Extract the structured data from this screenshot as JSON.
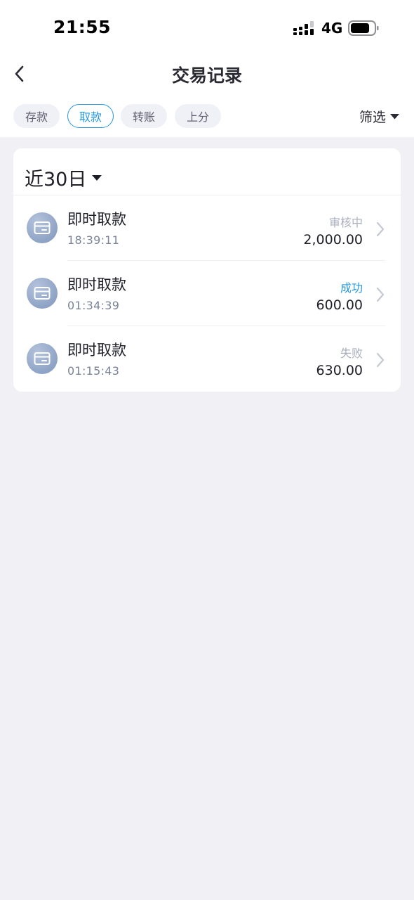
{
  "status_bar": {
    "time": "21:55",
    "network": "4G"
  },
  "nav": {
    "title": "交易记录"
  },
  "tabs": [
    {
      "label": "存款",
      "active": false
    },
    {
      "label": "取款",
      "active": true
    },
    {
      "label": "转账",
      "active": false
    },
    {
      "label": "上分",
      "active": false
    }
  ],
  "filter": {
    "label": "筛选",
    "icon": "caret-down-icon"
  },
  "period": {
    "label": "近30日",
    "icon": "caret-down-icon"
  },
  "transactions": [
    {
      "title": "即时取款",
      "time": "18:39:11",
      "status": "审核中",
      "amount": "2,000.00",
      "icon": "card-icon"
    },
    {
      "title": "即时取款",
      "time": "01:34:39",
      "status": "成功",
      "amount": "600.00",
      "icon": "card-icon"
    },
    {
      "title": "即时取款",
      "time": "01:15:43",
      "status": "失败",
      "amount": "630.00",
      "icon": "card-icon"
    }
  ],
  "colors": {
    "accent": "#2797dd",
    "background": "#f0f0f5",
    "muted": "#a9afbf"
  }
}
